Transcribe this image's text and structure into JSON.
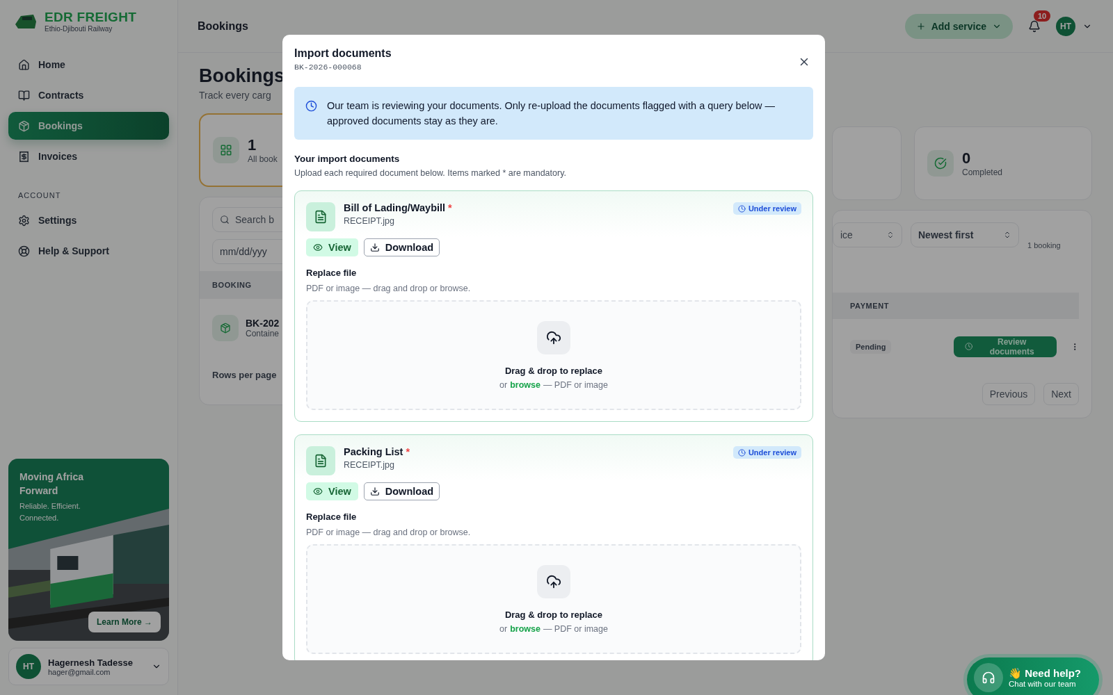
{
  "sidebar": {
    "brand": {
      "name": "EDR FREIGHT",
      "tagline": "Ethio-Djibouti Railway"
    },
    "nav": [
      {
        "label": "Home",
        "selected": false
      },
      {
        "label": "Contracts",
        "selected": false
      },
      {
        "label": "Bookings",
        "selected": true
      },
      {
        "label": "Invoices",
        "selected": false
      }
    ],
    "section_label": "ACCOUNT",
    "account_nav": [
      {
        "label": "Settings",
        "selected": false
      },
      {
        "label": "Help & Support",
        "selected": false
      }
    ],
    "promo": {
      "title": "Moving Africa Forward",
      "subtitle": "Reliable. Efficient. Connected.",
      "button": "Learn More →"
    },
    "user": {
      "initials": "HT",
      "name": "Hagernesh Tadesse",
      "email": "hager@gmail.com"
    }
  },
  "header": {
    "title": "Bookings",
    "add_service": "Add service",
    "notification_count": "10",
    "avatar": "HT"
  },
  "page": {
    "title": "Bookings",
    "subtitle": "Track every carg",
    "stats": [
      {
        "value": "1",
        "label": "All book",
        "highlighted": true
      },
      {
        "value": "0",
        "label": "Completed",
        "highlighted": false
      }
    ],
    "search": {
      "placeholder": "Search b"
    },
    "date": {
      "placeholder": "mm/dd/yyy"
    },
    "filter_select": "ice",
    "sort_select": "Newest first",
    "count": "1 booking",
    "table": {
      "columns": [
        "BOOKING",
        "PAYMENT"
      ],
      "row": {
        "id": "BK-202",
        "type": "Containe",
        "payment": "Pending",
        "action": "Review documents"
      }
    },
    "rows_per_page": "Rows per page",
    "pagination": [
      "Previous",
      "Next"
    ]
  },
  "modal": {
    "title": "Import documents",
    "reference": "BK-2026-000068",
    "notice": "Our team is reviewing your documents. Only re-upload the documents flagged with a query below — approved documents stay as they are.",
    "section_title": "Your import documents",
    "section_hint": "Upload each required document below. Items marked * are mandatory.",
    "documents": [
      {
        "name": "Bill of Lading/Waybill",
        "required_mark": "*",
        "file": "RECEIPT.jpg",
        "status": "Under review",
        "view": "View",
        "download": "Download",
        "replace_title": "Replace file",
        "replace_hint": "PDF or image — drag and drop or browse.",
        "drop_title": "Drag & drop to replace",
        "drop_prefix": "or",
        "drop_link": "browse",
        "drop_suffix": "— PDF or image"
      },
      {
        "name": "Packing List",
        "required_mark": "*",
        "file": "RECEIPT.jpg",
        "status": "Under review",
        "view": "View",
        "download": "Download",
        "replace_title": "Replace file",
        "replace_hint": "PDF or image — drag and drop or browse.",
        "drop_title": "Drag & drop to replace",
        "drop_prefix": "or",
        "drop_link": "browse",
        "drop_suffix": "— PDF or image"
      }
    ]
  },
  "help_chat": {
    "title": "👋 Need help?",
    "subtitle": "Chat with our team"
  }
}
